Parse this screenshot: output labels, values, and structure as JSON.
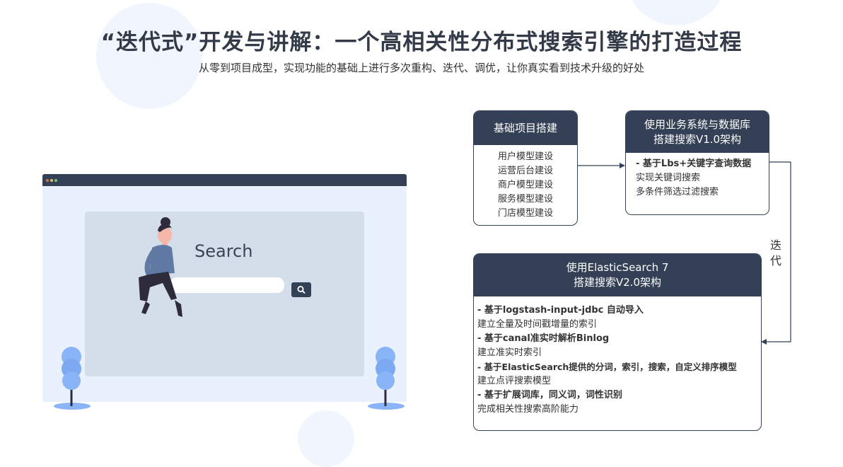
{
  "header": {
    "title": "“迭代式”开发与讲解：一个高相关性分布式搜索引擎的打造过程",
    "subtitle": "从零到项目成型，实现功能的基础上进行多次重构、迭代、调优，让你真实看到技术升级的好处"
  },
  "illustration": {
    "search_label": "Search",
    "icons": [
      "search-icon",
      "person-illustration",
      "tree-illustration"
    ]
  },
  "flow": {
    "box1": {
      "title": "基础项目搭建",
      "items": [
        "用户模型建设",
        "运营后台建设",
        "商户模型建设",
        "服务模型建设",
        "门店模型建设"
      ]
    },
    "box2": {
      "title_line1": "使用业务系统与数据库",
      "title_line2": "搭建搜索V1.0架构",
      "items": [
        {
          "text": " - 基于Lbs+关键字查询数据",
          "bold": true
        },
        {
          "text": "实现关键词搜索",
          "bold": false
        },
        {
          "text": "多条件筛选过滤搜索",
          "bold": false
        }
      ]
    },
    "iteration_label": "迭代",
    "box3": {
      "title_line1": "使用ElasticSearch 7",
      "title_line2": "搭建搜索V2.0架构",
      "items": [
        {
          "text": " - 基于logstash-input-jdbc 自动导入",
          "bold": true
        },
        {
          "text": "建立全量及时间戳增量的索引",
          "bold": false
        },
        {
          "text": " - 基于canal准实时解析Binlog",
          "bold": true
        },
        {
          "text": "建立准实时索引",
          "bold": false
        },
        {
          "text": " - 基于ElasticSearch提供的分词，索引，搜索，自定义排序模型",
          "bold": true
        },
        {
          "text": "建立点评搜索模型",
          "bold": false
        },
        {
          "text": " - 基于扩展词库，同义词，词性识别",
          "bold": true
        },
        {
          "text": "完成相关性搜索高阶能力",
          "bold": false
        }
      ]
    }
  },
  "colors": {
    "accent_dark": "#334056",
    "panel": "#d4deeb",
    "browser_bg": "#e8f1fd",
    "tree_blue": "#8ab4f8",
    "bg_circle": "#f1f5fd"
  }
}
